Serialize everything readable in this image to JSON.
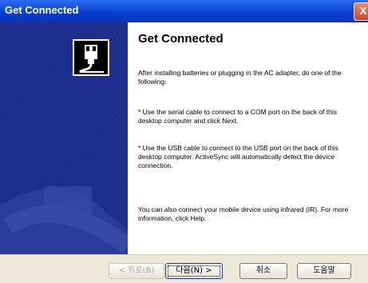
{
  "window": {
    "title": "Get Connected",
    "close_glyph": "X"
  },
  "left_panel": {
    "icon": "plug-connection-icon",
    "bg_color": "#1b2a8c"
  },
  "content": {
    "heading": "Get Connected",
    "para1": "After installing batteries or plugging in the AC adapter, do one of the following:",
    "para2": "* Use the serial cable to connect to a COM port on the back of this desktop computer and click Next.",
    "para3": "* Use the USB cable to connect to the USB port on the back of this desktop computer.   ActiveSync will automatically detect the device connection.",
    "para4": "You can also connect your mobile device using infrared (IR). For more information, click Help."
  },
  "buttons": {
    "back": "< 뒤로(B)",
    "next": "다음(N) >",
    "cancel": "취소",
    "help": "도움말"
  }
}
